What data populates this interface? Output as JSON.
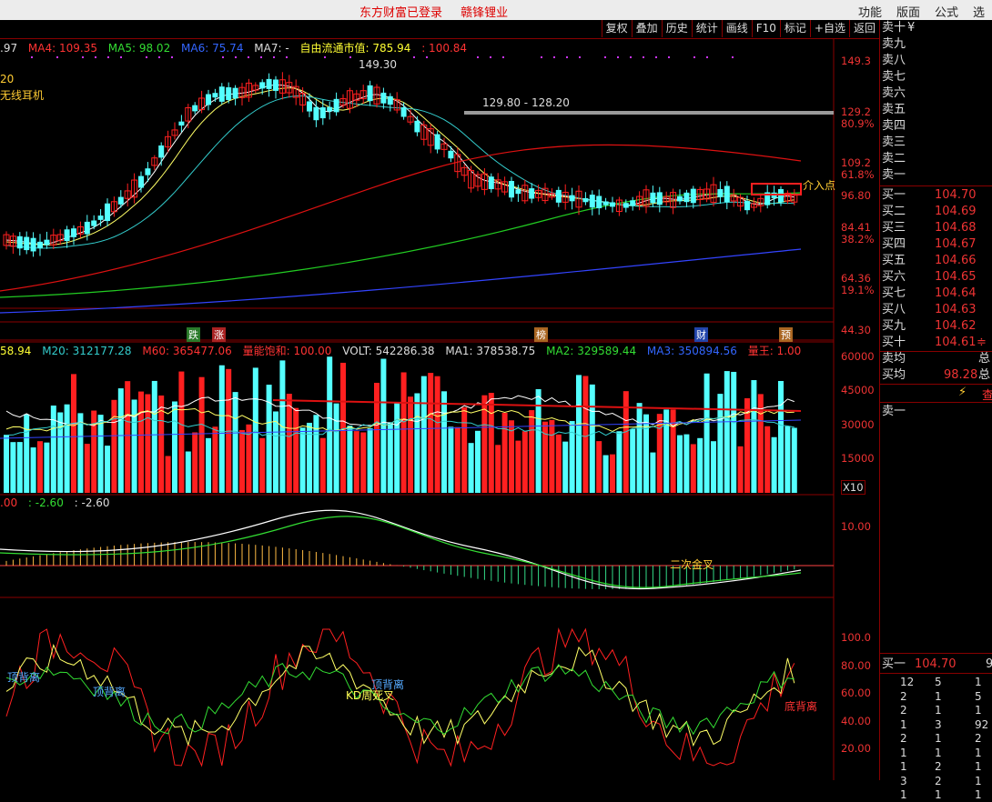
{
  "topbar": {
    "status": [
      "东方财富已登录",
      "赣锋锂业"
    ],
    "menu": [
      "功能",
      "版面",
      "公式",
      "选"
    ]
  },
  "toolbar": {
    "buttons": [
      "复权",
      "叠加",
      "历史",
      "统计",
      "画线",
      "F10",
      "标记",
      "+自选",
      "返回"
    ]
  },
  "main": {
    "ma_line": {
      "ma3": ".97",
      "ma4": "MA4: 109.35",
      "ma5": "MA5: 98.02",
      "ma6": "MA6: 75.74",
      "ma7": "MA7: -",
      "float_cap": "自由流通市值: 785.94",
      "extra": ": 100.84"
    },
    "title_stub": "20",
    "concept": "无线耳机",
    "high_label": "149.30",
    "range_label": "129.80 - 128.20",
    "entry_label": "介入点",
    "axis": [
      "149.3",
      "129.2",
      "80.9%",
      "109.2",
      "61.8%",
      "96.80",
      "84.41",
      "38.2%",
      "64.36",
      "19.1%",
      "44.30"
    ],
    "event_tags": [
      "跌",
      "涨",
      "榜",
      "财",
      "预"
    ],
    "colors": {
      "up": "#ff2020",
      "down": "#54ffff",
      "ma_white": "#ffffff",
      "ma_yellow": "#ffff66",
      "ma_cyan": "#33cccc",
      "ma_red": "#dd1111",
      "ma_green": "#22cc22",
      "ma_blue": "#3344ff"
    }
  },
  "volume": {
    "labels": {
      "m10": "58.94",
      "m20": "M20: 312177.28",
      "m60": "M60: 365477.06",
      "sat": "量能饱和: 100.00",
      "volt": "VOLT: 542286.38",
      "ma1": "MA1: 378538.75",
      "ma2": "MA2: 329589.44",
      "ma3": "MA3: 350894.56",
      "king": "量王: 1.00"
    },
    "axis": [
      "60000",
      "45000",
      "30000",
      "15000"
    ],
    "unit": "X10"
  },
  "macd": {
    "labels": {
      "a": ".00",
      "b": ": -2.60",
      "c": ": -2.60"
    },
    "axis": [
      "10.00"
    ],
    "note": "二次金叉"
  },
  "kdj": {
    "axis": [
      "100.0",
      "80.00",
      "60.00",
      "40.00",
      "20.00"
    ],
    "notes": [
      "顶背离",
      "顶背离",
      "KD周死叉",
      "顶背离",
      "底背离"
    ]
  },
  "orderbook": {
    "sell": [
      "卖十",
      "卖九",
      "卖八",
      "卖七",
      "卖六",
      "卖五",
      "卖四",
      "卖三",
      "卖二",
      "卖一"
    ],
    "sell_top_suffix": "¥",
    "buy": [
      {
        "label": "买一",
        "price": "104.70"
      },
      {
        "label": "买二",
        "price": "104.69"
      },
      {
        "label": "买三",
        "price": "104.68"
      },
      {
        "label": "买四",
        "price": "104.67"
      },
      {
        "label": "买五",
        "price": "104.66"
      },
      {
        "label": "买六",
        "price": "104.65"
      },
      {
        "label": "买七",
        "price": "104.64"
      },
      {
        "label": "买八",
        "price": "104.63"
      },
      {
        "label": "买九",
        "price": "104.62"
      },
      {
        "label": "买十",
        "price": "104.61"
      }
    ],
    "buy_last_suffix": "≑",
    "avg": [
      {
        "label": "卖均",
        "value": "",
        "tail": "总"
      },
      {
        "label": "买均",
        "value": "98.28",
        "tail": "总"
      }
    ],
    "tab_icon": "lightning-icon",
    "tab_label": "查",
    "sell1_row": "卖一",
    "buy1": {
      "label": "买一",
      "price": "104.70",
      "tail": "9"
    },
    "volumes": [
      [
        "12",
        "5",
        "1"
      ],
      [
        "2",
        "1",
        "5"
      ],
      [
        "2",
        "1",
        "1"
      ],
      [
        "1",
        "3",
        "92"
      ],
      [
        "2",
        "1",
        "2"
      ],
      [
        "1",
        "1",
        "1"
      ],
      [
        "1",
        "2",
        "1"
      ],
      [
        "3",
        "2",
        "1"
      ],
      [
        "1",
        "1",
        "1"
      ]
    ]
  }
}
